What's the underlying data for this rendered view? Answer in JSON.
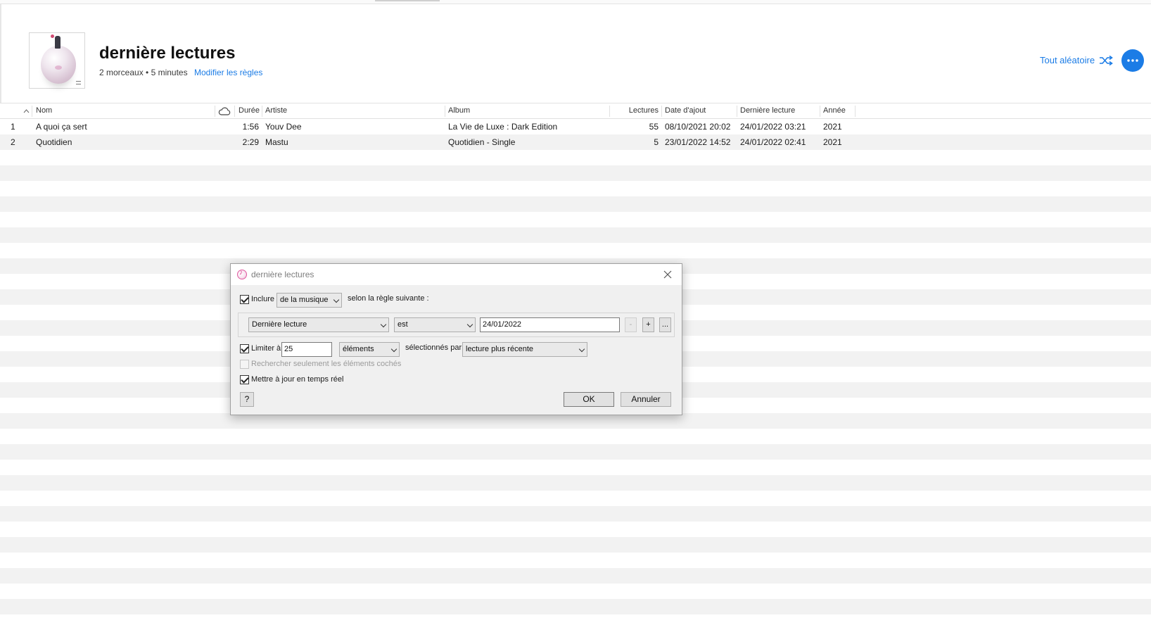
{
  "playlist": {
    "title": "dernière lectures",
    "meta": "2 morceaux • 5 minutes",
    "edit_rules_label": "Modifier les règles",
    "shuffle_label": "Tout aléatoire",
    "shuffle_icon": "shuffle-icon",
    "more_icon": "ellipsis-icon",
    "accent_color": "#1b7ce6"
  },
  "table": {
    "columns": {
      "name": "Nom",
      "duration": "Durée",
      "artist": "Artiste",
      "album": "Album",
      "plays": "Lectures",
      "date_added": "Date d'ajout",
      "last_played": "Dernière lecture",
      "year": "Année"
    },
    "rows": [
      {
        "index": "1",
        "name": "A quoi ça sert",
        "duration": "1:56",
        "artist": "Youv Dee",
        "album": "La Vie de Luxe : Dark Edition",
        "plays": "55",
        "date_added": "08/10/2021 20:02",
        "last_played": "24/01/2022 03:21",
        "year": "2021"
      },
      {
        "index": "2",
        "name": "Quotidien",
        "duration": "2:29",
        "artist": "Mastu",
        "album": "Quotidien - Single",
        "plays": "5",
        "date_added": "23/01/2022 14:52",
        "last_played": "24/01/2022 02:41",
        "year": "2021"
      }
    ]
  },
  "dialog": {
    "title": "dernière lectures",
    "include_label": "Inclure",
    "include_checked": true,
    "include_source": "de la musique",
    "rule_suffix": "selon la règle suivante :",
    "rule": {
      "field": "Dernière lecture",
      "operator": "est",
      "value": "24/01/2022",
      "remove_label": "-",
      "add_label": "+",
      "more_label": "..."
    },
    "limit_label": "Limiter à",
    "limit_checked": true,
    "limit_value": "25",
    "limit_unit": "éléments",
    "selected_by_label": "sélectionnés par",
    "selected_by": "lecture plus récente",
    "checked_only_label": "Rechercher seulement les éléments cochés",
    "checked_only_checked": false,
    "live_update_label": "Mettre à jour en temps réel",
    "live_update_checked": true,
    "help_label": "?",
    "ok_label": "OK",
    "cancel_label": "Annuler"
  }
}
